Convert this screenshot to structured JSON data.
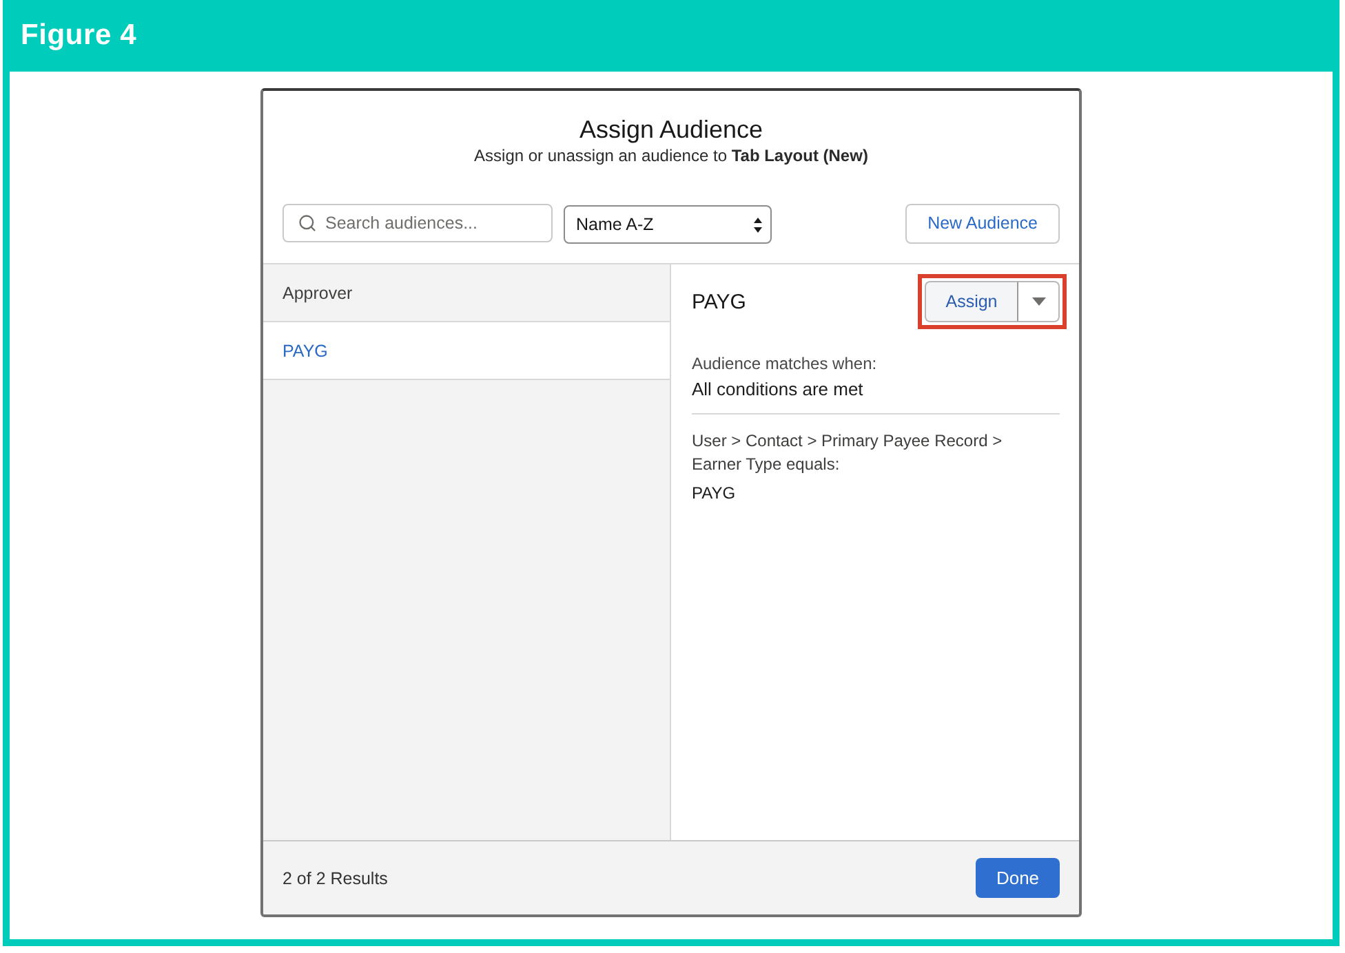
{
  "figure": {
    "title": "Figure 4"
  },
  "modal": {
    "title": "Assign Audience",
    "subtitle": "Assign or unassign an audience to **Tab Layout (New)**"
  },
  "toolbar": {
    "search": {
      "placeholder": "Search audiences..."
    },
    "sort": {
      "value": "Name A-Z"
    },
    "new_button": "New Audience"
  },
  "audiences": [
    {
      "label": "Approver",
      "selected": false
    },
    {
      "label": "PAYG",
      "selected": true
    }
  ],
  "detail": {
    "title": "PAYG",
    "assign": {
      "label": "Assign",
      "highlighted": true
    },
    "match_label": "Audience matches when:",
    "match_value": "All conditions are met",
    "criteria": "User > Contact > Primary Payee Record > Earner Type equals:",
    "criteria_value": "PAYG"
  },
  "footer": {
    "results": "2 of 2 Results",
    "done_button": "Done"
  }
}
